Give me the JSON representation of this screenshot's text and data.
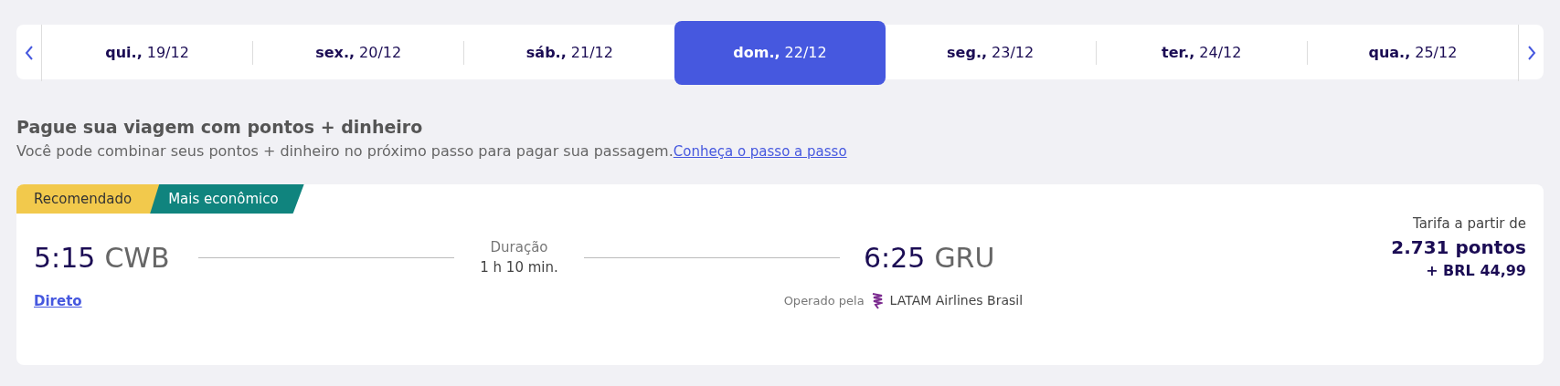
{
  "dates": [
    {
      "day": "qui.,",
      "date": "19/12",
      "selected": false
    },
    {
      "day": "sex.,",
      "date": "20/12",
      "selected": false
    },
    {
      "day": "sáb.,",
      "date": "21/12",
      "selected": false
    },
    {
      "day": "dom.,",
      "date": "22/12",
      "selected": true
    },
    {
      "day": "seg.,",
      "date": "23/12",
      "selected": false
    },
    {
      "day": "ter.,",
      "date": "24/12",
      "selected": false
    },
    {
      "day": "qua.,",
      "date": "25/12",
      "selected": false
    }
  ],
  "promo": {
    "title": "Pague sua viagem com pontos + dinheiro",
    "text": "Você pode combinar seus pontos + dinheiro no próximo passo para pagar sua passagem.",
    "link": "Conheça o passo a passo"
  },
  "flight": {
    "badges": [
      {
        "label": "Recomendado",
        "color": "#f2c94c"
      },
      {
        "label": "Mais econômico",
        "color": "#10847e"
      }
    ],
    "departure_time": "5:15",
    "departure_airport": "CWB",
    "duration_label": "Duração",
    "duration": "1 h 10 min.",
    "arrival_time": "6:25",
    "arrival_airport": "GRU",
    "stops_link": "Direto",
    "operated_by": "Operado pela",
    "airline": "LATAM Airlines Brasil",
    "fare_label": "Tarifa a partir de",
    "points": "2.731 pontos",
    "cash": "+ BRL 44,99"
  }
}
